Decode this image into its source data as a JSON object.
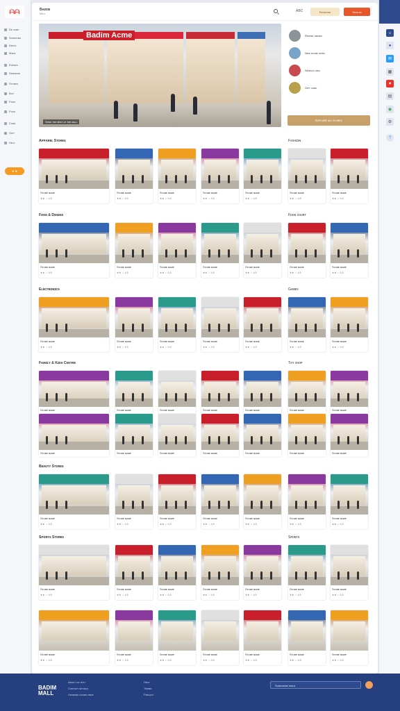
{
  "app": {
    "logo": "ᗩᗩ",
    "brand_title": "Bᴀᴅɪᴍ",
    "brand_sub": "Mᴀʟʟ"
  },
  "left_nav": {
    "items": [
      "Dᴇ ᴠᴏʀᴇ",
      "Sʜᴏᴘᴘɪɴɢ",
      "Dᴇᴀʟs",
      "Mᴀᴘs",
      "Eᴠᴇɴᴛs",
      "Sᴇʀᴠɪᴄᴇs",
      "Sᴛᴏʀᴇs",
      "Bᴜʏ",
      "Pᴀʀᴋ",
      "Fᴏᴏᴅ",
      "Cᴀʀᴅ",
      "Gɪғᴛ",
      "Hᴇʟᴘ"
    ],
    "pill_label": "● ●"
  },
  "header": {
    "lang": "ABC",
    "btn1": "Rᴇɢɪsᴛᴇʀ",
    "btn2": "Sɪɢɴ ɪɴ"
  },
  "hero": {
    "sign": "Badim Acme",
    "caption": "Sʜᴏᴘ ᴛʜᴇ ʙᴇsᴛ ᴏғ ᴛʜᴇ ᴍᴀʟʟ"
  },
  "right_panel": {
    "items": [
      "Rᴇᴄᴇɴᴛ ᴏʀᴅᴇʀ",
      "Nᴇᴡ sᴛᴏʀᴇ ᴏᴘᴇɴ",
      "Wᴇᴇᴋʟʏ ᴅᴇᴀʟ",
      "Gɪғᴛ ᴄᴀʀᴅ"
    ],
    "cta": "Exᴘʟᴏʀᴇ ᴀʟʟ sᴛᴏʀᴇs"
  },
  "sections": [
    {
      "title": "Aᴘᴘᴀʀᴇʟ Sᴛᴏʀᴇs",
      "side": "Fᴀsʜɪᴏɴ"
    },
    {
      "title": "Fᴏᴏᴅ & Dɪɴɪɴɢ",
      "side": "Fᴏᴏᴅ ᴄᴏᴜʀᴛ"
    },
    {
      "title": "Eʟᴇᴄᴛʀᴏɴɪᴄs",
      "side": "Gᴀᴍᴇs"
    },
    {
      "title": "Fᴀᴍɪʟʏ & Kɪᴅs Cᴇɴᴛʀᴇ",
      "side": "Tᴏʏ sʜᴏᴘ"
    },
    {
      "title": "Bᴇᴀᴜᴛʏ Sᴛᴏʀᴇs",
      "side": ""
    },
    {
      "title": "Sᴘᴏʀᴛs Sᴛᴏʀᴇs",
      "side": "Sᴘᴏʀᴛs"
    }
  ],
  "card_label": "Sᴛᴏʀᴇ ɴᴀᴍᴇ",
  "card_meta": "★★ ☆ 4.5",
  "footer": {
    "logo": "BADIM\nMALL",
    "col1": [
      "Aʙᴏᴜᴛ ᴜs ᴛᴇxᴛ",
      "Cᴏɴᴛᴀᴄᴛ ᴅᴇᴛᴀɪʟs",
      "Oᴘᴇɴɪɴɢ ʜᴏᴜʀs ʜᴇʀᴇ"
    ],
    "col2": [
      "Hᴇʟᴘ",
      "Tᴇʀᴍs",
      "Pʀɪᴠᴀᴄʏ"
    ],
    "newsletter": "Sᴜʙsᴄʀɪʙᴇ ᴇᴍᴀɪʟ"
  }
}
